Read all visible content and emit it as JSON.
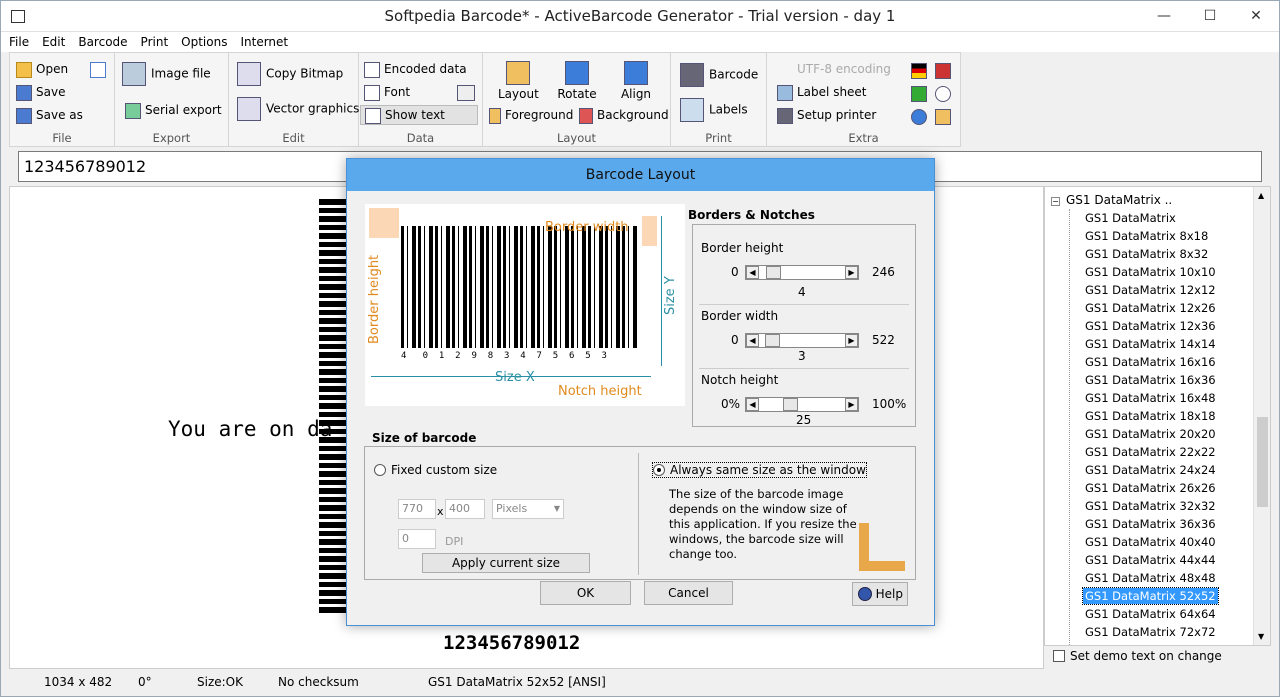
{
  "window": {
    "title": "Softpedia Barcode*  - ActiveBarcode Generator - Trial version - day 1",
    "min": "—",
    "max": "☐",
    "close": "✕"
  },
  "menu": [
    "File",
    "Edit",
    "Barcode",
    "Print",
    "Options",
    "Internet"
  ],
  "ribbon": {
    "file": {
      "open": "Open",
      "save": "Save",
      "save_as": "Save as",
      "label": "File"
    },
    "export": {
      "image_file": "Image file",
      "serial_export": "Serial export",
      "label": "Export"
    },
    "edit": {
      "copy_bitmap": "Copy Bitmap",
      "vector_graphics": "Vector graphics",
      "label": "Edit"
    },
    "data": {
      "encoded_data": "Encoded data",
      "font": "Font",
      "show_text": "Show text",
      "label": "Data"
    },
    "layout": {
      "layout": "Layout",
      "rotate": "Rotate",
      "align": "Align",
      "foreground": "Foreground",
      "background": "Background",
      "label": "Layout"
    },
    "print": {
      "barcode": "Barcode",
      "labels": "Labels",
      "label": "Print"
    },
    "extra": {
      "utf8": "UTF-8 encoding",
      "label_sheet": "Label sheet",
      "setup_printer": "Setup printer",
      "label": "Extra"
    }
  },
  "address_value": "123456789012",
  "canvas": {
    "demo_text": "You are on da",
    "barcode_number": "123456789012"
  },
  "tree": {
    "root": "GS1 DataMatrix ..",
    "items": [
      "GS1 DataMatrix",
      "GS1 DataMatrix  8x18",
      "GS1 DataMatrix  8x32",
      "GS1 DataMatrix  10x10",
      "GS1 DataMatrix  12x12",
      "GS1 DataMatrix  12x26",
      "GS1 DataMatrix  12x36",
      "GS1 DataMatrix  14x14",
      "GS1 DataMatrix  16x16",
      "GS1 DataMatrix  16x36",
      "GS1 DataMatrix  16x48",
      "GS1 DataMatrix  18x18",
      "GS1 DataMatrix  20x20",
      "GS1 DataMatrix  22x22",
      "GS1 DataMatrix  24x24",
      "GS1 DataMatrix  26x26",
      "GS1 DataMatrix  32x32",
      "GS1 DataMatrix  36x36",
      "GS1 DataMatrix  40x40",
      "GS1 DataMatrix  44x44",
      "GS1 DataMatrix  48x48",
      "GS1 DataMatrix  52x52",
      "GS1 DataMatrix  64x64",
      "GS1 DataMatrix  72x72"
    ],
    "selected_index": 21
  },
  "demo_checkbox": "Set demo text on change",
  "status": {
    "size": "1034 x 482",
    "angle": "0°",
    "state": "Size:OK",
    "checksum": "No checksum",
    "type": "GS1 DataMatrix 52x52 [ANSI]"
  },
  "dialog": {
    "title": "Barcode Layout",
    "illustration": {
      "border_width": "Border width",
      "border_height": "Border height",
      "size_x": "Size X",
      "size_y": "Size Y",
      "notch_height": "Notch height",
      "digits": "4   0  1  2  9  8  3  4  7  5  6  5  3"
    },
    "borders_title": "Borders & Notches",
    "border_height": {
      "label": "Border height",
      "min": "0",
      "max": "246",
      "value": "4",
      "fraction": 0.016
    },
    "border_width": {
      "label": "Border width",
      "min": "0",
      "max": "522",
      "value": "3",
      "fraction": 0.006
    },
    "notch_height": {
      "label": "Notch height",
      "min": "0%",
      "max": "100%",
      "value": "25",
      "fraction": 0.25
    },
    "size_title": "Size of barcode",
    "fixed_custom": "Fixed custom size",
    "width_value": "770",
    "x_sep": "x",
    "height_value": "400",
    "unit": "Pixels",
    "dpi_value": "0",
    "dpi_label": "DPI",
    "apply": "Apply current size",
    "always_same": "Always same size as the window",
    "description": "The size of the barcode image depends on the window size of this application. If you resize the windows, the barcode size will change too.",
    "ok": "OK",
    "cancel": "Cancel",
    "help": "Help"
  }
}
